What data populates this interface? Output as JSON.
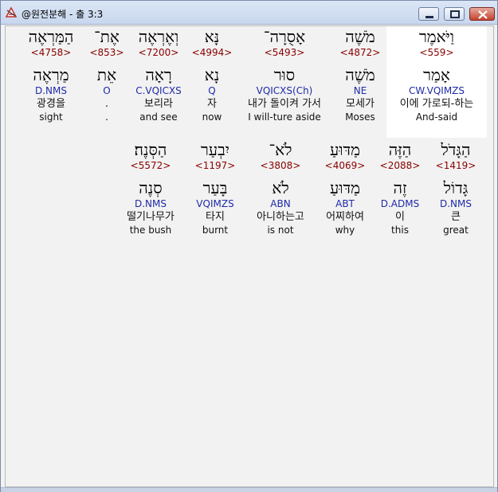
{
  "window": {
    "title": "@원전분해 - 출 3:3"
  },
  "words": [
    {
      "hebrew": "וַיֹּאמֶר",
      "strong": "<559>",
      "lemma": "אָמַר",
      "parse": "CW.VQIMZS",
      "korean": "이에 가로되-하는",
      "english": "And-said"
    },
    {
      "hebrew": "מֹשֶׁה",
      "strong": "<4872>",
      "lemma": "מֹשֶׁה",
      "parse": "NE",
      "korean": "모세가",
      "english": "Moses"
    },
    {
      "hebrew": "אָסֻרָה־",
      "strong": "<5493>",
      "lemma": "סוּר",
      "parse": "VQICXS(Ch)",
      "korean": "내가 돌이켜 가서",
      "english": "I will-ture aside"
    },
    {
      "hebrew": "נָּא",
      "strong": "<4994>",
      "lemma": "נָא",
      "parse": "Q",
      "korean": "자",
      "english": "now"
    },
    {
      "hebrew": "וְאֶרְאֶה",
      "strong": "<7200>",
      "lemma": "רָאָה",
      "parse": "C.VQICXS",
      "korean": "보리라",
      "english": "and see"
    },
    {
      "hebrew": "אֶת־",
      "strong": "<853>",
      "lemma": "אֵת",
      "parse": "O",
      "korean": ".",
      "english": "."
    },
    {
      "hebrew": "הַמַּרְאֶה",
      "strong": "<4758>",
      "lemma": "מַרְאֶה",
      "parse": "D.NMS",
      "korean": "광경을",
      "english": "sight"
    },
    {
      "hebrew": "הַגָּדֹל",
      "strong": "<1419>",
      "lemma": "גָּדוֹל",
      "parse": "D.NMS",
      "korean": "큰",
      "english": "great"
    },
    {
      "hebrew": "הַזֶּה",
      "strong": "<2088>",
      "lemma": "זֶה",
      "parse": "D.ADMS",
      "korean": "이",
      "english": "this"
    },
    {
      "hebrew": "מַדּוּעַ",
      "strong": "<4069>",
      "lemma": "מַדּוּעַ",
      "parse": "ABT",
      "korean": "어찌하여",
      "english": "why"
    },
    {
      "hebrew": "לֹא־",
      "strong": "<3808>",
      "lemma": "לֹא",
      "parse": "ABN",
      "korean": "아니하는고",
      "english": "is not"
    },
    {
      "hebrew": "יִבְעַר",
      "strong": "<1197>",
      "lemma": "בָּעַר",
      "parse": "VQIMZS",
      "korean": "타지",
      "english": "burnt"
    },
    {
      "hebrew": "הַסְּנֶה׃",
      "strong": "<5572>",
      "lemma": "סְנֶה",
      "parse": "D.NMS",
      "korean": "떨기나무가",
      "english": "the bush"
    }
  ],
  "icons": {
    "app": "app-logo-icon",
    "minimize": "minimize-icon",
    "maximize": "maximize-icon",
    "close": "close-icon"
  }
}
